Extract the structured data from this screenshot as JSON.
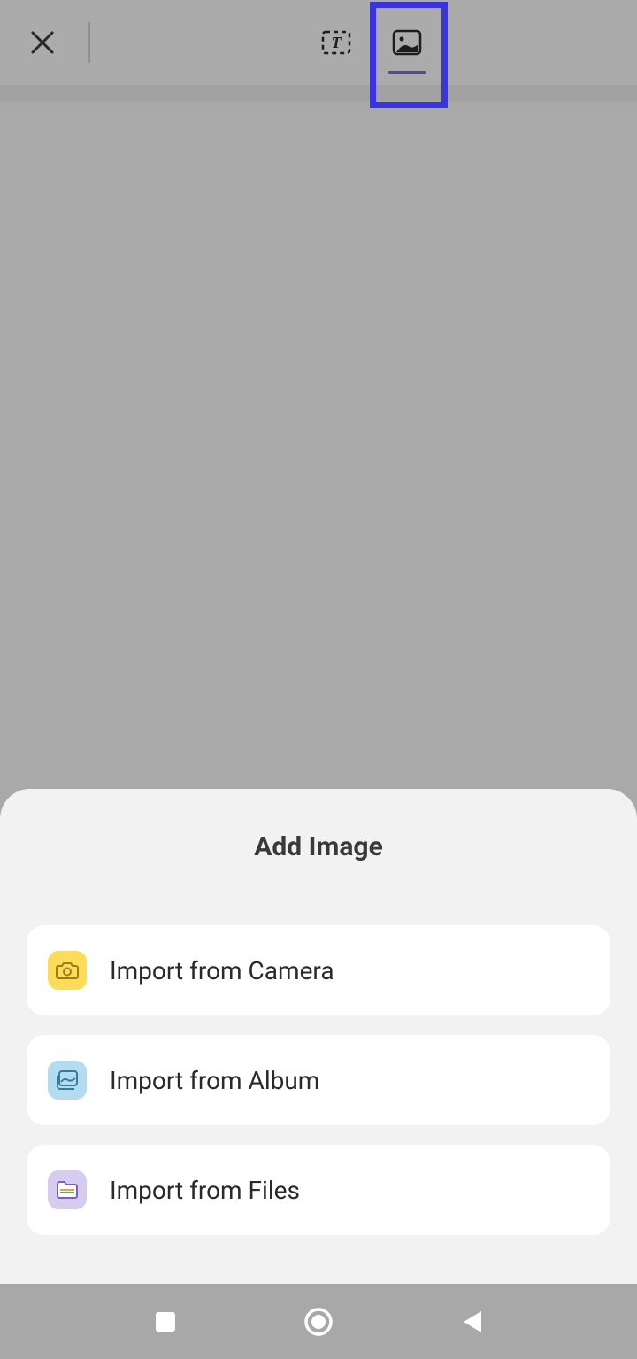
{
  "topbar": {
    "tabs": {
      "text": "text-tab",
      "image": "image-tab"
    }
  },
  "sheet": {
    "title": "Add Image",
    "options": [
      {
        "label": "Import from Camera"
      },
      {
        "label": "Import from Album"
      },
      {
        "label": "Import from Files"
      }
    ]
  }
}
